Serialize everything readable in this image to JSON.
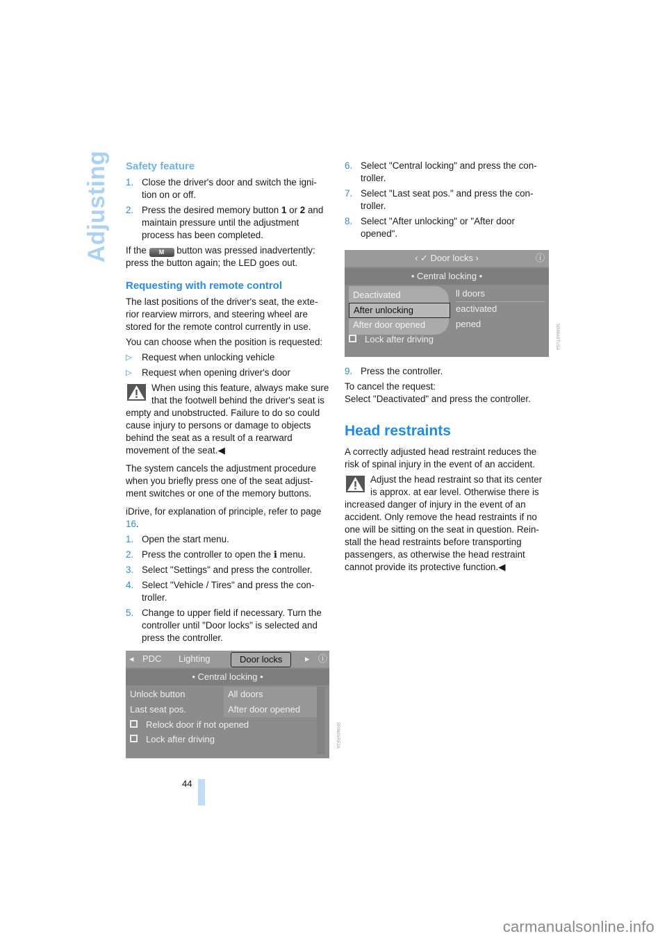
{
  "section_tab": "Adjusting",
  "left_column": {
    "safety": {
      "heading": "Safety feature",
      "steps": [
        {
          "num": "1.",
          "text": "Close the driver's door and switch the igni-tion on or off."
        },
        {
          "num": "2.",
          "pre": "Press the desired memory button ",
          "b1": "1",
          "mid": " or ",
          "b2": "2",
          "post": " and maintain pressure until the adjustment process has been completed."
        }
      ],
      "note_pre": "If the ",
      "m_button_label": "M",
      "note_post": " button was pressed inadvertently: press the button again; the LED goes out."
    },
    "remote": {
      "heading": "Requesting with remote control",
      "para1": "The last positions of the driver's seat, the exte-rior rearview mirrors, and steering wheel are stored for the remote control currently in use.",
      "para2": "You can choose when the position is requested:",
      "bullets": [
        "Request when unlocking vehicle",
        "Request when opening driver's door"
      ],
      "warning": "When using this feature, always make sure that the footwell behind the driver's seat is empty and unobstructed. Failure to do so could cause injury to persons or damage to objects behind the seat as a result of a rearward movement of the seat.",
      "end_mark": "◀",
      "para3": "The system cancels the adjustment procedure when you briefly press one of the seat adjust-ment switches or one of the memory buttons.",
      "idrive_ref_pre": "iDrive, for explanation of principle, refer to page ",
      "idrive_ref_page": "16",
      "idrive_ref_post": ".",
      "steps": [
        {
          "num": "1.",
          "text": "Open the start menu."
        },
        {
          "num": "2.",
          "pre": "Press the controller to open the ",
          "icon": "i",
          "post": " menu."
        },
        {
          "num": "3.",
          "text": "Select \"Settings\" and press the controller."
        },
        {
          "num": "4.",
          "text": "Select \"Vehicle / Tires\" and press the con-troller."
        },
        {
          "num": "5.",
          "text": "Change to upper field if necessary. Turn the controller until \"Door locks\" is selected and press the controller."
        }
      ]
    },
    "screen1": {
      "tabs": [
        "PDC",
        "Lighting",
        "Door locks"
      ],
      "active_tab": "Door locks",
      "subheader": "• Central locking •",
      "rows": [
        {
          "label": "Unlock button",
          "value": "All doors"
        },
        {
          "label": "Last seat pos.",
          "value": "After door opened"
        }
      ],
      "checkboxes": [
        "Relock door if not opened",
        "Lock after driving"
      ],
      "image_code": "SR88A5RE2A"
    }
  },
  "right_column": {
    "steps": [
      {
        "num": "6.",
        "text": "Select \"Central locking\" and press the con-troller."
      },
      {
        "num": "7.",
        "text": "Select \"Last seat pos.\" and press the con-troller."
      },
      {
        "num": "8.",
        "text": "Select \"After unlocking\" or \"After door opened\"."
      }
    ],
    "screen2": {
      "header": "‹ ✓ Door locks ›",
      "subheader": "• Central locking •",
      "popup_options": [
        "Deactivated",
        "After unlocking",
        "After door opened"
      ],
      "selected_option": "After unlocking",
      "behind_values": [
        "ll doors",
        "eactivated",
        "pened"
      ],
      "checkbox": "Lock after driving",
      "image_code": "SR88A5TUSA"
    },
    "step9": {
      "num": "9.",
      "text": "Press the controller."
    },
    "cancel_line1": "To cancel the request:",
    "cancel_line2": "Select \"Deactivated\" and press the controller.",
    "head_restraints": {
      "heading": "Head restraints",
      "para": "A correctly adjusted head restraint reduces the risk of spinal injury in the event of an accident.",
      "warning": "Adjust the head restraint so that its center is approx. at ear level. Otherwise there is increased danger of injury in the event of an accident. Only remove the head restraints if no one will be sitting on the seat in question. Rein-stall the head restraints before transporting passengers, as otherwise the head restraint cannot provide its protective function.",
      "end_mark": "◀"
    }
  },
  "page_number": "44",
  "footer_watermark": "carmanualsonline.info"
}
